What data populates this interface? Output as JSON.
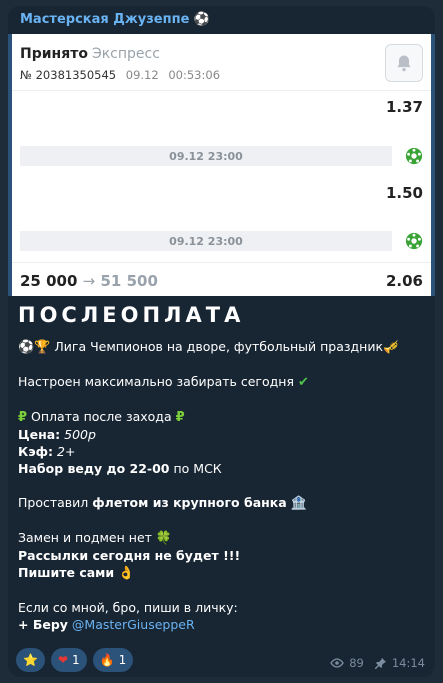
{
  "channel": {
    "name": "Мастерская Джузеппе",
    "name_emoji": "⚽"
  },
  "bet_card": {
    "status": "Принято",
    "bet_type": "Экспресс",
    "number": "№ 20381350545",
    "date": "09.12",
    "time": "00:53:06",
    "events": [
      {
        "odd": "1.37",
        "datetime": "09.12 23:00"
      },
      {
        "odd": "1.50",
        "datetime": "09.12 23:00"
      }
    ],
    "stake": "25 000",
    "arrow": "→",
    "payout": "51 500",
    "total_odd": "2.06"
  },
  "message": {
    "headline": "ПОСЛЕОПЛАТА",
    "l1_emoji": "⚽🏆",
    "l1_text": "Лига Чемпионов на дворе, футбольный праздник",
    "l1_end": "🎺",
    "l2_text": "Настроен максимально забирать сегодня",
    "l2_end": "✔",
    "l3_emoji": "₽",
    "l3_text": "Оплата после захода",
    "l3_end": "₽",
    "price_label": "Цена:",
    "price_value": "500р",
    "coef_label": "Кэф:",
    "coef_value": "2+",
    "recruit_bold": "Набор веду до 22-00",
    "recruit_rest": "по МСК",
    "l7_pre": "Проставил",
    "l7_bold": "флетом из крупного банка",
    "l7_end": "🏦",
    "l8_text": "Замен и подмен нет",
    "l8_end": "🍀",
    "l9_text": "Рассылки сегодня не будет !!!",
    "l10_text": "Пишите сами",
    "l10_end": "👌",
    "l11_text": "Если со мной, бро, пиши в личку:",
    "l12_pre": "+ Беру",
    "l12_link": "@MasterGiuseppeR"
  },
  "reactions": [
    {
      "emoji": "⭐",
      "count": ""
    },
    {
      "emoji": "❤",
      "count": "1"
    },
    {
      "emoji": "🔥",
      "count": "1"
    }
  ],
  "meta": {
    "views": "89",
    "time": "14:14",
    "icons": [
      "eye-icon",
      "pin-icon"
    ]
  },
  "colors": {
    "channel_name": "#6ab3f3",
    "bubble": "#182533",
    "reaction_bg": "#2b5278",
    "ball_green": "#3aa335"
  }
}
